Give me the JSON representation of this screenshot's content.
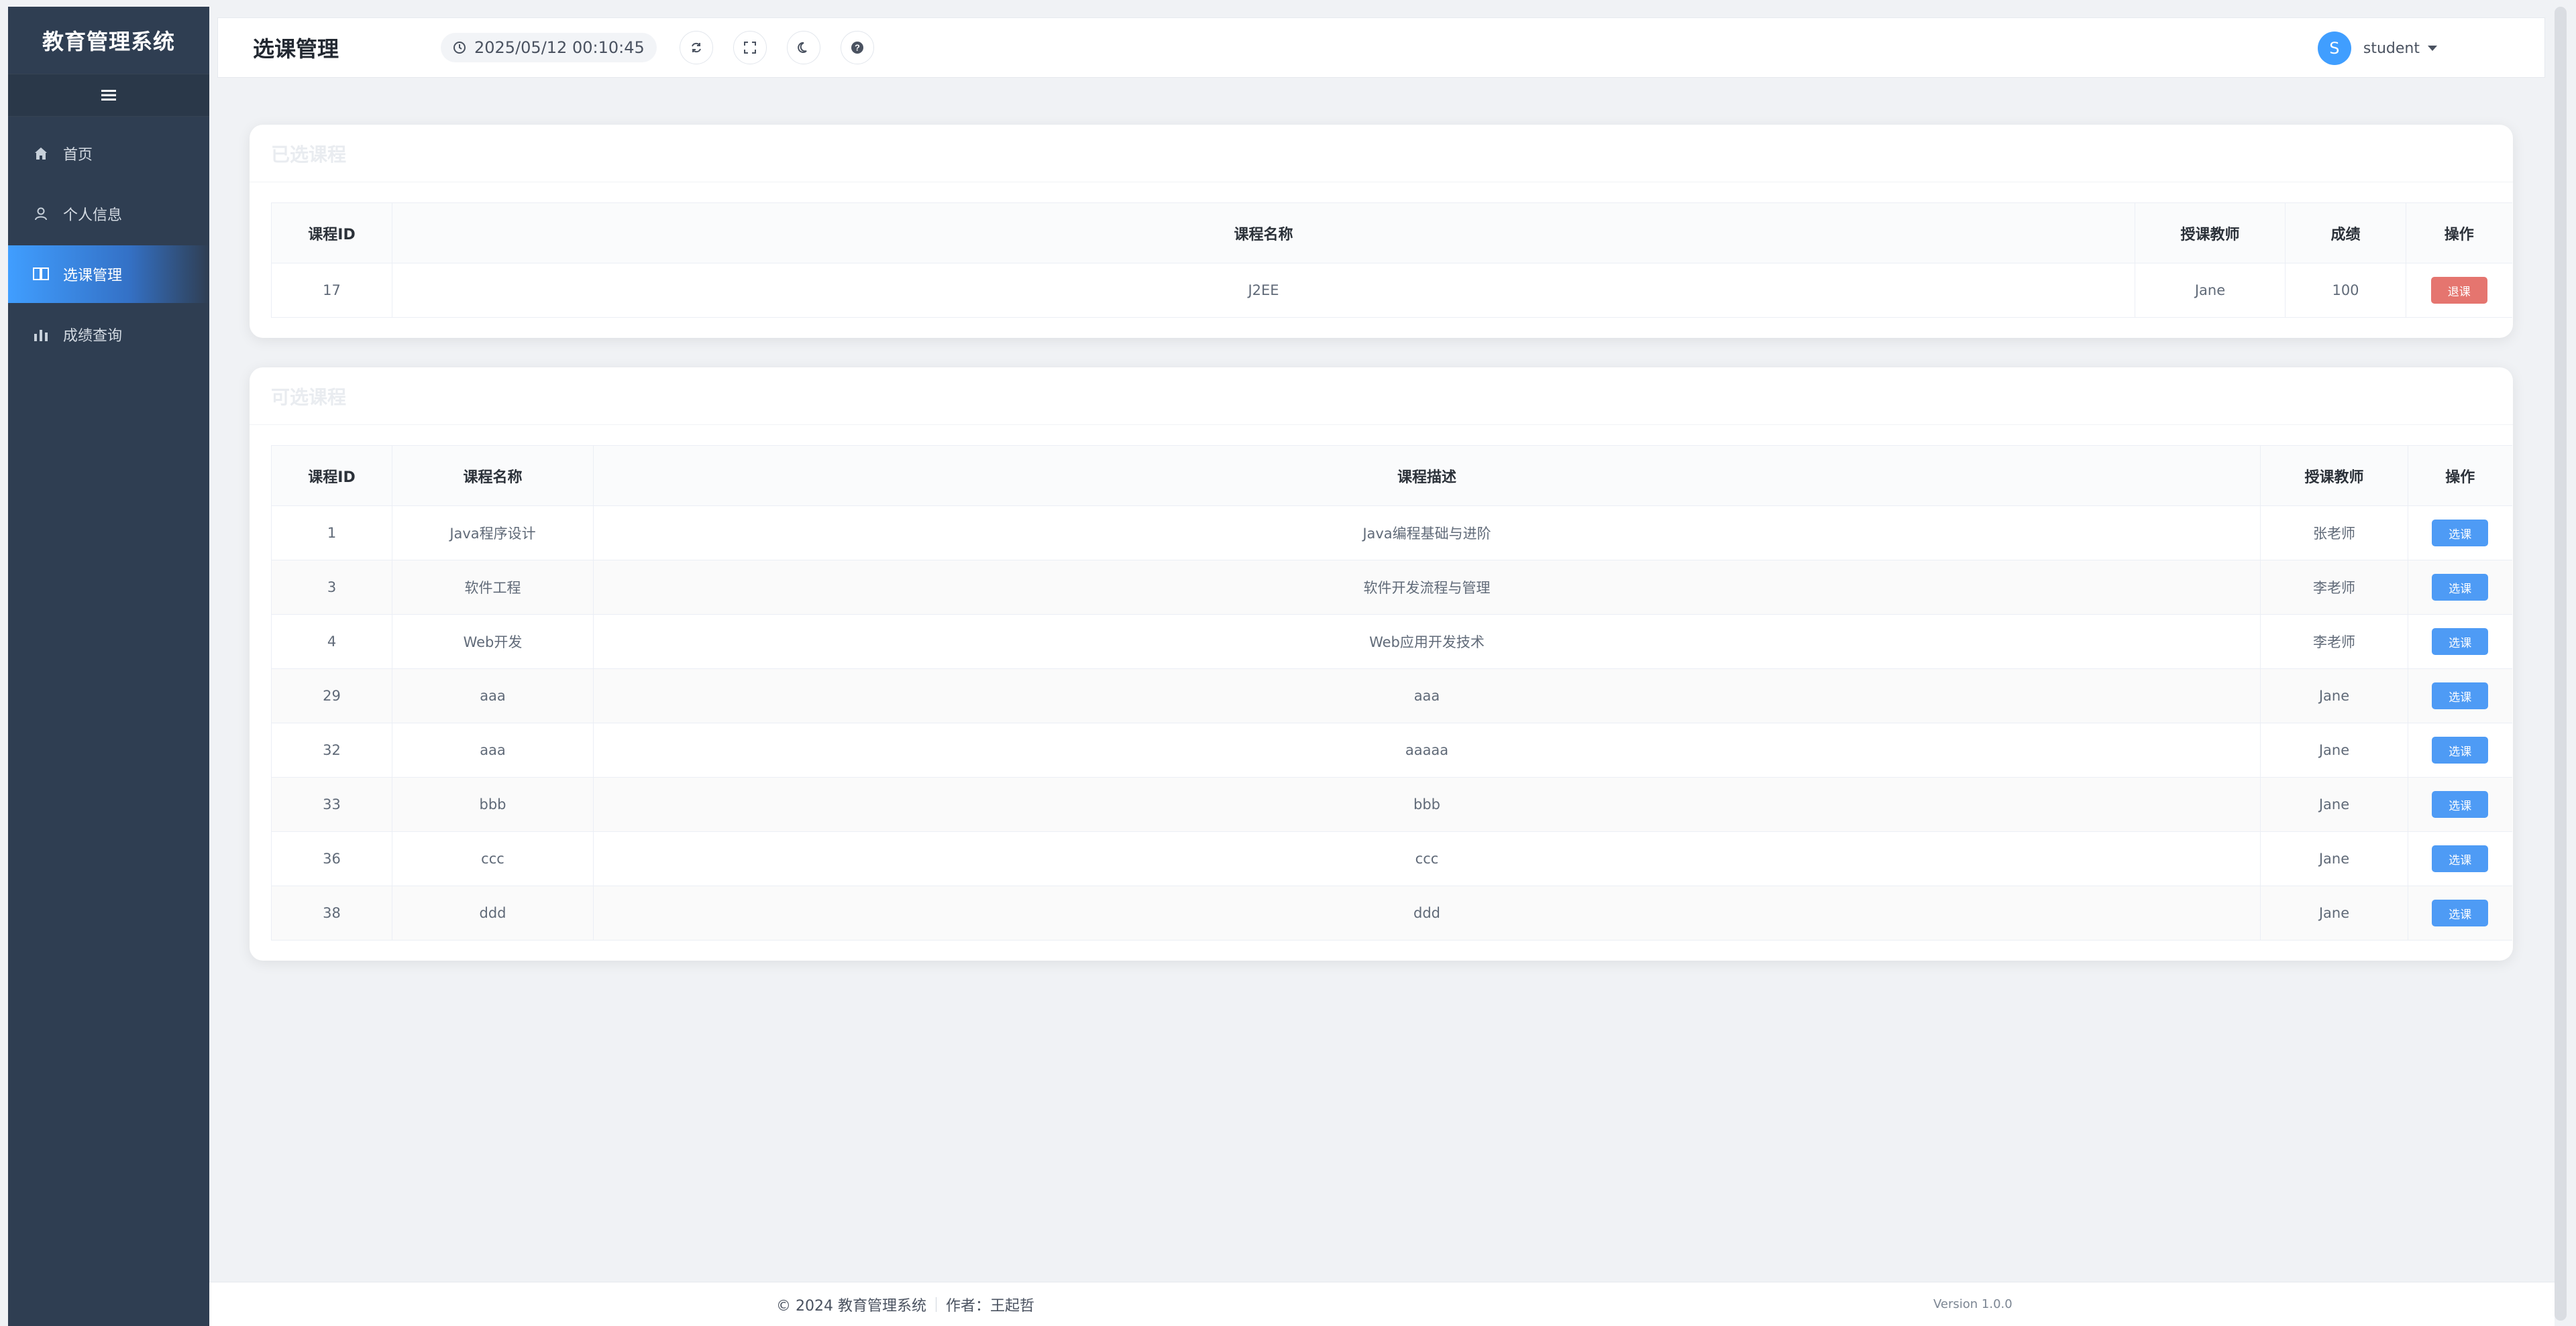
{
  "sidebar": {
    "brand": "教育管理系统",
    "items": [
      {
        "label": "首页",
        "icon": "home-icon"
      },
      {
        "label": "个人信息",
        "icon": "user-icon"
      },
      {
        "label": "选课管理",
        "icon": "book-icon",
        "active": true
      },
      {
        "label": "成绩查询",
        "icon": "bar-chart-icon"
      }
    ]
  },
  "header": {
    "title": "选课管理",
    "datetime": "2025/05/12 00:10:45",
    "user": {
      "avatar_letter": "S",
      "name": "student"
    }
  },
  "selected_courses": {
    "title": "已选课程",
    "columns": [
      "课程ID",
      "课程名称",
      "授课教师",
      "成绩",
      "操作"
    ],
    "rows": [
      {
        "id": "17",
        "name": "J2EE",
        "teacher": "Jane",
        "score": "100",
        "action": "退课"
      }
    ]
  },
  "available_courses": {
    "title": "可选课程",
    "columns": [
      "课程ID",
      "课程名称",
      "课程描述",
      "授课教师",
      "操作"
    ],
    "rows": [
      {
        "id": "1",
        "name": "Java程序设计",
        "desc": "Java编程基础与进阶",
        "teacher": "张老师",
        "action": "选课"
      },
      {
        "id": "3",
        "name": "软件工程",
        "desc": "软件开发流程与管理",
        "teacher": "李老师",
        "action": "选课"
      },
      {
        "id": "4",
        "name": "Web开发",
        "desc": "Web应用开发技术",
        "teacher": "李老师",
        "action": "选课"
      },
      {
        "id": "29",
        "name": "aaa",
        "desc": "aaa",
        "teacher": "Jane",
        "action": "选课"
      },
      {
        "id": "32",
        "name": "aaa",
        "desc": "aaaaa",
        "teacher": "Jane",
        "action": "选课"
      },
      {
        "id": "33",
        "name": "bbb",
        "desc": "bbb",
        "teacher": "Jane",
        "action": "选课"
      },
      {
        "id": "36",
        "name": "ccc",
        "desc": "ccc",
        "teacher": "Jane",
        "action": "选课"
      },
      {
        "id": "38",
        "name": "ddd",
        "desc": "ddd",
        "teacher": "Jane",
        "action": "选课"
      }
    ]
  },
  "footer": {
    "copyright": "© 2024 教育管理系统",
    "author": "作者：王起哲",
    "version": "Version 1.0.0"
  },
  "colors": {
    "sidebar_bg": "#2f3e52",
    "accent": "#409eff",
    "danger": "#e5756f"
  }
}
